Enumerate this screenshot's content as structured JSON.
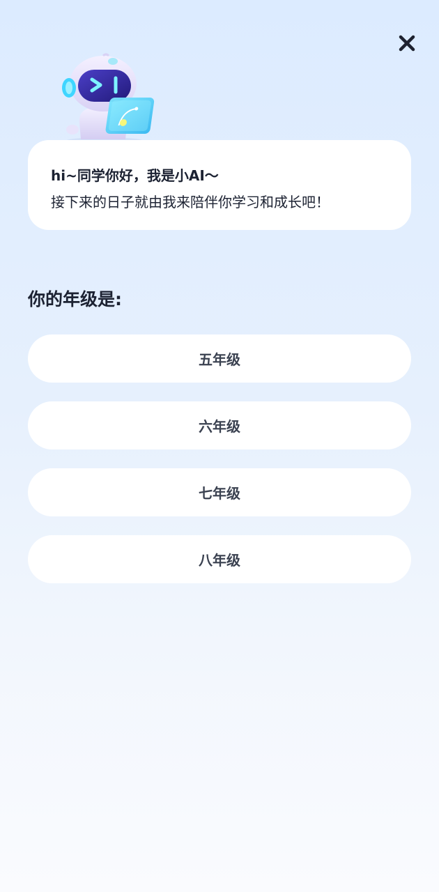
{
  "greeting": {
    "line1": "hi~同学你好，我是小AI～",
    "line2": "接下来的日子就由我来陪伴你学习和成长吧！"
  },
  "question": {
    "title": "你的年级是:"
  },
  "grades": [
    {
      "label": "五年级"
    },
    {
      "label": "六年级"
    },
    {
      "label": "七年级"
    },
    {
      "label": "八年级"
    }
  ],
  "icons": {
    "close": "close-icon",
    "mascot": "robot-mascot"
  },
  "colors": {
    "background_top": "#dcebff",
    "background_bottom": "#fafbfe",
    "card": "#ffffff",
    "text": "#1c2232",
    "option_text": "#3a4150"
  }
}
